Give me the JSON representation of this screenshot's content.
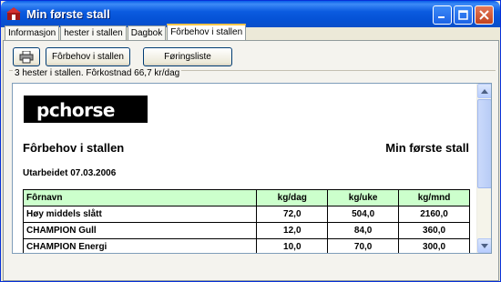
{
  "window": {
    "title": "Min første stall",
    "accent": "#0552d6"
  },
  "tabs": [
    {
      "label": "Informasjon",
      "active": false
    },
    {
      "label": "hester i stallen",
      "active": false
    },
    {
      "label": "Dagbok",
      "active": false
    },
    {
      "label": "Fôrbehov i stallen",
      "active": true
    }
  ],
  "toolbar": {
    "print_icon": "printer-icon",
    "btn_forbehov": "Fôrbehov i stallen",
    "btn_foringsliste": "Føringsliste"
  },
  "status": {
    "text": "3 hester i stallen. Fôrkostnad 66,7 kr/dag"
  },
  "report": {
    "logo": "pchorse",
    "title": "Fôrbehov i stallen",
    "stable": "Min første stall",
    "date": "Utarbeidet 07.03.2006",
    "header_color": "#ccffcc",
    "columns": [
      "Fôrnavn",
      "kg/dag",
      "kg/uke",
      "kg/mnd"
    ],
    "rows": [
      [
        "Høy middels slått",
        "72,0",
        "504,0",
        "2160,0"
      ],
      [
        "CHAMPION Gull",
        "12,0",
        "84,0",
        "360,0"
      ],
      [
        "CHAMPION Energi",
        "10,0",
        "70,0",
        "300,0"
      ]
    ]
  }
}
